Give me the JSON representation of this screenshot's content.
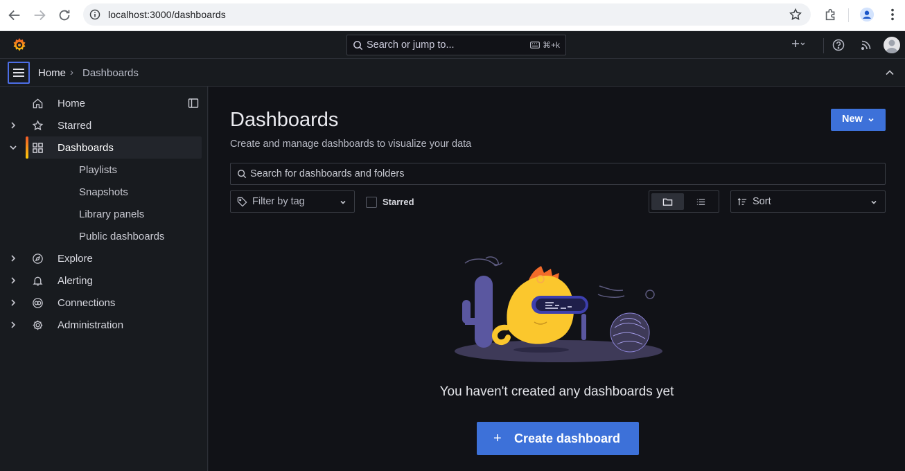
{
  "browser": {
    "url": "localhost:3000/dashboards"
  },
  "topbar": {
    "search_placeholder": "Search or jump to...",
    "search_shortcut": "⌘+k"
  },
  "breadcrumb": {
    "home": "Home",
    "separator": "›",
    "current": "Dashboards"
  },
  "sidebar": {
    "items": [
      {
        "label": "Home",
        "icon": "home-icon",
        "expandable": false
      },
      {
        "label": "Starred",
        "icon": "star-icon",
        "expandable": true
      },
      {
        "label": "Dashboards",
        "icon": "apps-icon",
        "expandable": true,
        "expanded": true,
        "active": true
      },
      {
        "label": "Playlists",
        "sub": true
      },
      {
        "label": "Snapshots",
        "sub": true
      },
      {
        "label": "Library panels",
        "sub": true
      },
      {
        "label": "Public dashboards",
        "sub": true
      },
      {
        "label": "Explore",
        "icon": "compass-icon",
        "expandable": true
      },
      {
        "label": "Alerting",
        "icon": "bell-icon",
        "expandable": true
      },
      {
        "label": "Connections",
        "icon": "connections-icon",
        "expandable": true
      },
      {
        "label": "Administration",
        "icon": "cog-icon",
        "expandable": true
      }
    ]
  },
  "main": {
    "title": "Dashboards",
    "subtitle": "Create and manage dashboards to visualize your data",
    "new_button": "New",
    "search_placeholder": "Search for dashboards and folders",
    "filter_placeholder": "Filter by tag",
    "starred_label": "Starred",
    "starred_checked": false,
    "view_mode": "folders",
    "sort_placeholder": "Sort",
    "empty_message": "You haven't created any dashboards yet",
    "create_button": "Create dashboard",
    "create_icon": "+"
  },
  "colors": {
    "accent": "#3d71d9",
    "sidebar_bg": "#181b1f",
    "main_bg": "#111217",
    "active_bar_top": "#f05a28",
    "active_bar_bottom": "#fbca0a"
  }
}
